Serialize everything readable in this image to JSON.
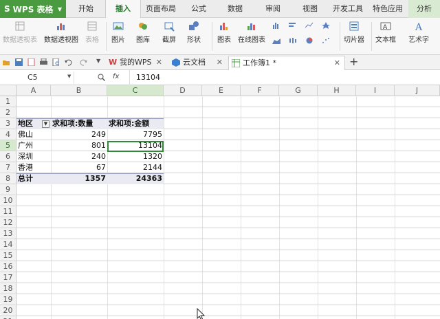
{
  "app": {
    "name": "WPS 表格"
  },
  "menu_tabs": [
    "开始",
    "插入",
    "页面布局",
    "公式",
    "数据",
    "审阅",
    "视图",
    "开发工具",
    "特色应用",
    "分析"
  ],
  "active_tab": "插入",
  "ribbon": {
    "pivot_table": "数据透视表",
    "pivot_chart": "数据透视图",
    "table": "表格",
    "picture": "图片",
    "gallery": "图库",
    "screenshot": "截屏",
    "shapes": "形状",
    "chart": "图表",
    "online_chart": "在线图表",
    "slicer": "切片器",
    "textbox": "文本框",
    "wordart": "艺术字"
  },
  "doc_tabs": [
    {
      "label": "我的WPS"
    },
    {
      "label": "云文档"
    },
    {
      "label": "工作簿1 *"
    }
  ],
  "formula_bar": {
    "cell_ref": "C5",
    "fx": "fx",
    "value": "13104"
  },
  "columns": [
    "A",
    "B",
    "C",
    "D",
    "E",
    "F",
    "G",
    "H",
    "I",
    "J"
  ],
  "rows": [
    "1",
    "2",
    "3",
    "4",
    "5",
    "6",
    "7",
    "8",
    "9",
    "10",
    "11",
    "12",
    "13",
    "14",
    "15",
    "16",
    "17",
    "18",
    "19",
    "20",
    "21"
  ],
  "pivot": {
    "headers": [
      "地区",
      "求和项:数量",
      "求和项:金额"
    ],
    "rows": [
      {
        "region": "佛山",
        "qty": "249",
        "amount": "7795"
      },
      {
        "region": "广州",
        "qty": "801",
        "amount": "13104"
      },
      {
        "region": "深圳",
        "qty": "240",
        "amount": "1320"
      },
      {
        "region": "香港",
        "qty": "67",
        "amount": "2144"
      }
    ],
    "total": {
      "label": "总计",
      "qty": "1357",
      "amount": "24363"
    }
  },
  "colors": {
    "brand_green": "#4a9b3f",
    "selection": "#2f8a3a"
  }
}
